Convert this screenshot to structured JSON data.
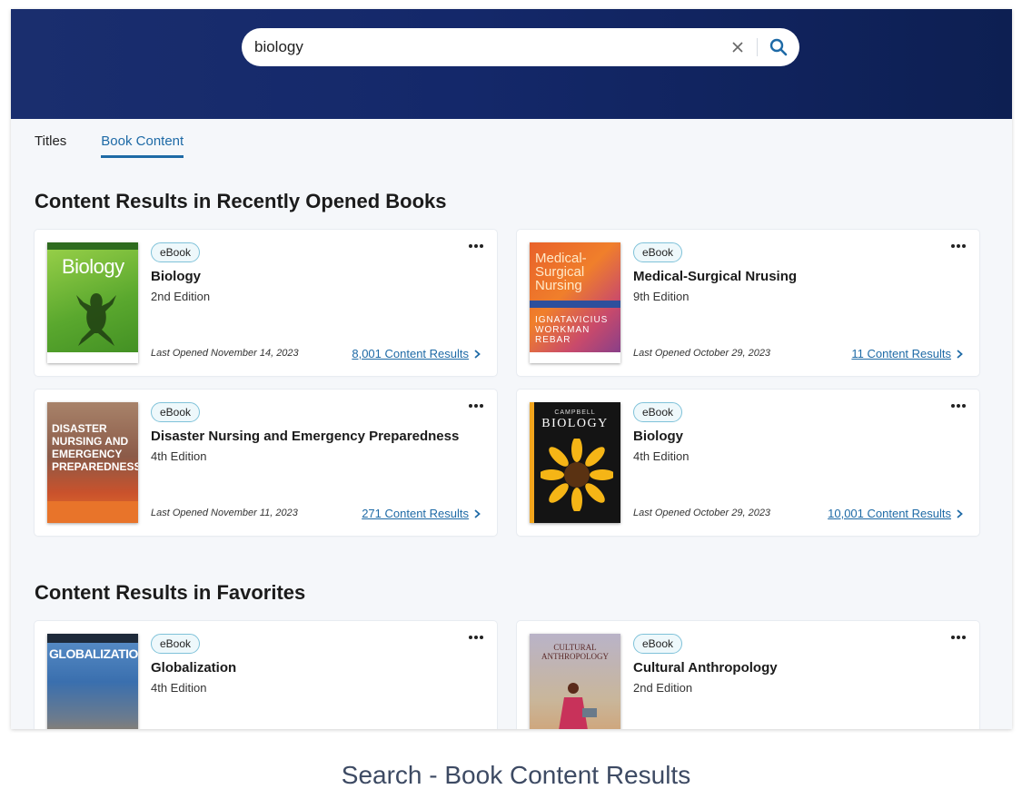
{
  "search": {
    "query": "biology"
  },
  "tabs": [
    {
      "label": "Titles",
      "active": false
    },
    {
      "label": "Book Content",
      "active": true
    }
  ],
  "sections": {
    "recent_title": "Content Results in Recently Opened Books",
    "favorites_title": "Content Results in Favorites"
  },
  "recent": [
    {
      "badge": "eBook",
      "title": "Biology",
      "edition": "2nd Edition",
      "opened": "Last Opened November 14, 2023",
      "results": "8,001 Content Results",
      "cover_title": "Biology"
    },
    {
      "badge": "eBook",
      "title": "Medical-Surgical Nrusing",
      "edition": "9th Edition",
      "opened": "Last Opened October 29, 2023",
      "results": "11 Content Results",
      "cover_title": "Medical-Surgical Nursing",
      "cover_authors": "IGNATAVICIUS WORKMAN REBAR"
    },
    {
      "badge": "eBook",
      "title": "Disaster Nursing and Emergency Preparedness",
      "edition": "4th Edition",
      "opened": "Last Opened November 11, 2023",
      "results": "271 Content Results",
      "cover_title": "DISASTER NURSING AND EMERGENCY PREPAREDNESS"
    },
    {
      "badge": "eBook",
      "title": "Biology",
      "edition": "4th Edition",
      "opened": "Last Opened October 29, 2023",
      "results": "10,001 Content Results",
      "cover_title": "BIOLOGY",
      "cover_brand": "CAMPBELL"
    }
  ],
  "favorites": [
    {
      "badge": "eBook",
      "title": "Globalization",
      "edition": "4th Edition",
      "cover_title": "GLOBALIZATION"
    },
    {
      "badge": "eBook",
      "title": "Cultural Anthropology",
      "edition": "2nd Edition",
      "cover_title": "CULTURAL ANTHROPOLOGY"
    }
  ],
  "caption": "Search - Book Content Results",
  "colors": {
    "header": "#14286a",
    "accent": "#1e6aa6",
    "badge_border": "#7fc2d9"
  }
}
